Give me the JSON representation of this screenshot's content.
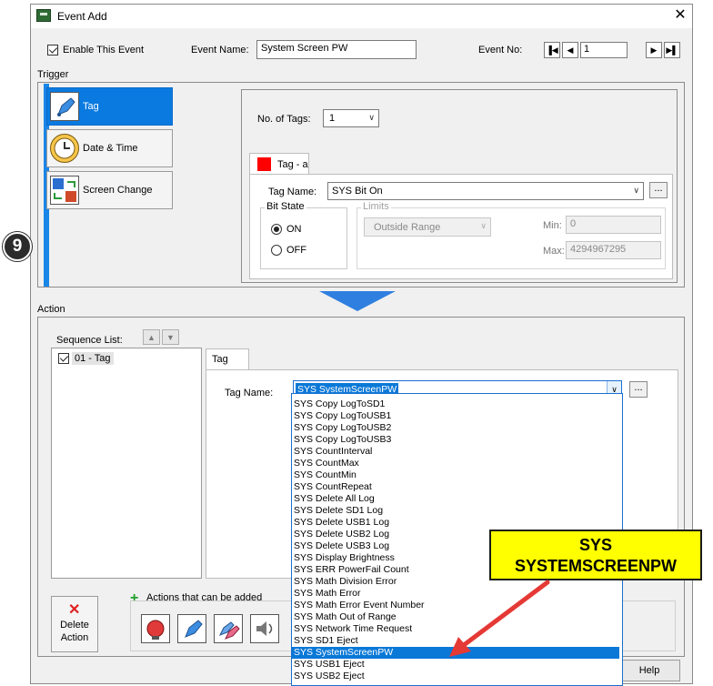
{
  "window": {
    "title": "Event Add",
    "close_glyph": "✕"
  },
  "header": {
    "enable_label": "Enable This Event",
    "event_name_label": "Event Name:",
    "event_name_value": "System Screen PW",
    "event_no_label": "Event No:",
    "event_no_value": "1"
  },
  "trigger": {
    "section_label": "Trigger",
    "buttons": [
      {
        "label": "Tag",
        "icon": "tag-icon"
      },
      {
        "label": "Date & Time",
        "icon": "clock-icon"
      },
      {
        "label": "Screen Change",
        "icon": "screen-change-icon"
      }
    ],
    "tags_count_label": "No. of Tags:",
    "tags_count_value": "1",
    "tab_label": "Tag - a",
    "tab_color": "#ff0000",
    "tag_name_label": "Tag Name:",
    "tag_name_value": "SYS Bit On",
    "bit_state_label": "Bit State",
    "on_label": "ON",
    "off_label": "OFF",
    "limits_label": "Limits",
    "limits_value": "Outside Range",
    "min_label": "Min:",
    "min_value": "0",
    "max_label": "Max:",
    "max_value": "4294967295"
  },
  "step_badge": "9",
  "action": {
    "section_label": "Action",
    "sequence_label": "Sequence List:",
    "sequence_items": [
      "01 - Tag"
    ],
    "tab_label": "Tag",
    "tag_name_label": "Tag Name:",
    "tag_name_value": "SYS SystemScreenPW",
    "dropdown_items": [
      "SYS Copy LogToSD1",
      "SYS Copy LogToUSB1",
      "SYS Copy LogToUSB2",
      "SYS Copy LogToUSB3",
      "SYS CountInterval",
      "SYS CountMax",
      "SYS CountMin",
      "SYS CountRepeat",
      "SYS Delete All Log",
      "SYS Delete SD1 Log",
      "SYS Delete USB1 Log",
      "SYS Delete USB2 Log",
      "SYS Delete USB3 Log",
      "SYS Display Brightness",
      "SYS ERR PowerFail Count",
      "SYS Math Division Error",
      "SYS Math Error",
      "SYS Math Error Event Number",
      "SYS Math Out of Range",
      "SYS Network Time Request",
      "SYS SD1 Eject",
      "SYS SystemScreenPW",
      "SYS USB1 Eject",
      "SYS USB2 Eject"
    ],
    "selected_item": "SYS SystemScreenPW",
    "delete_label_1": "Delete",
    "delete_label_2": "Action",
    "actions_added_label": "Actions that can be added",
    "help_label": "Help"
  },
  "callout": {
    "line1": "SYS",
    "line2": "SYSTEMSCREENPW",
    "bg": "#ffff00",
    "arrow": "#e53935"
  },
  "colors": {
    "accent": "#0a7ae0",
    "arrow_blue": "#2f7fe0"
  }
}
